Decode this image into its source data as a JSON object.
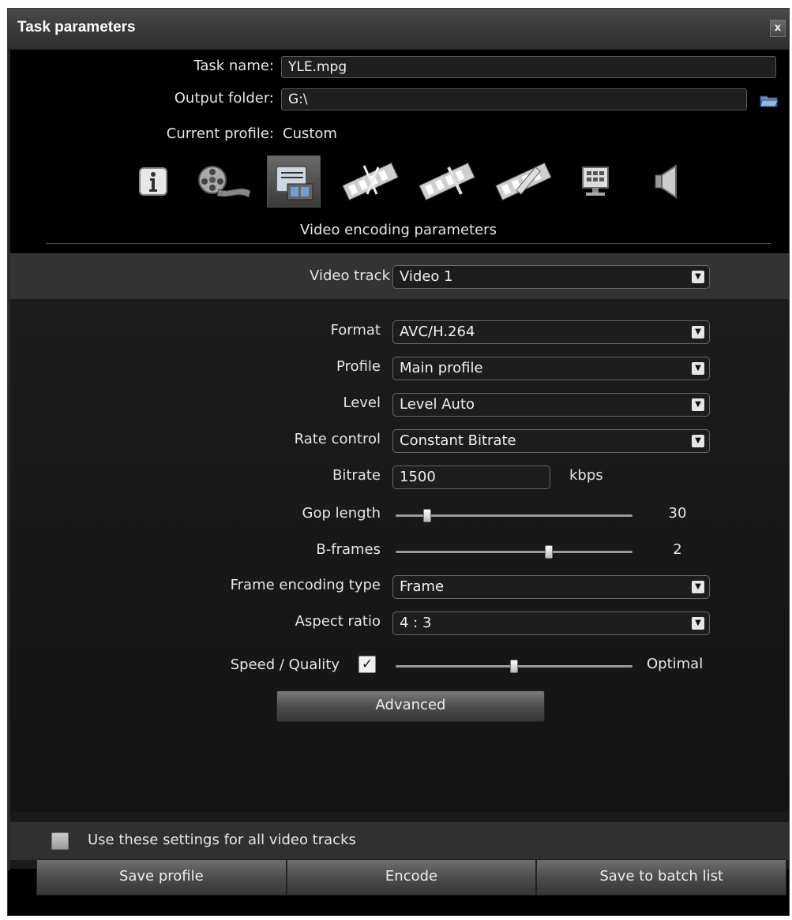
{
  "window": {
    "title": "Task parameters",
    "close_label": "x"
  },
  "header": {
    "task_name_label": "Task name:",
    "task_name_value": "YLE.mpg",
    "output_folder_label": "Output folder:",
    "output_folder_value": "G:\\",
    "current_profile_label": "Current profile:",
    "current_profile_value": "Custom"
  },
  "profile_tabs": [
    {
      "icon": "info-icon",
      "active": false
    },
    {
      "icon": "film-reel-icon",
      "active": false
    },
    {
      "icon": "video-settings-icon",
      "active": true
    },
    {
      "icon": "film-scissors-icon",
      "active": false
    },
    {
      "icon": "film-pen-icon",
      "active": false
    },
    {
      "icon": "film-ruler-icon",
      "active": false
    },
    {
      "icon": "monitor-icon",
      "active": false
    },
    {
      "icon": "speaker-icon",
      "active": false
    }
  ],
  "section_title": "Video encoding parameters",
  "video_track": {
    "label": "Video track",
    "value": "Video 1"
  },
  "params": {
    "format": {
      "label": "Format",
      "value": "AVC/H.264"
    },
    "profile": {
      "label": "Profile",
      "value": "Main profile"
    },
    "level": {
      "label": "Level",
      "value": "Level Auto"
    },
    "rate_control": {
      "label": "Rate control",
      "value": "Constant Bitrate"
    },
    "bitrate": {
      "label": "Bitrate",
      "value": "1500",
      "unit": "kbps"
    },
    "gop_length": {
      "label": "Gop length",
      "value": "30",
      "slider_fraction": 0.12
    },
    "b_frames": {
      "label": "B-frames",
      "value": "2",
      "slider_fraction": 0.65
    },
    "frame_encoding_type": {
      "label": "Frame encoding type",
      "value": "Frame"
    },
    "aspect_ratio": {
      "label": "Aspect ratio",
      "value": "4 : 3"
    },
    "speed_quality": {
      "label": "Speed / Quality",
      "checked": true,
      "value": "Optimal",
      "slider_fraction": 0.5
    }
  },
  "advanced_label": "Advanced",
  "all_tracks": {
    "label": "Use these settings for all video tracks",
    "checked": false
  },
  "footer": {
    "save_profile": "Save profile",
    "encode": "Encode",
    "save_batch": "Save to batch list"
  },
  "colors": {
    "background": "#000000",
    "panel": "#1a1a1a",
    "band": "#333333",
    "text": "#e6e6e6"
  }
}
